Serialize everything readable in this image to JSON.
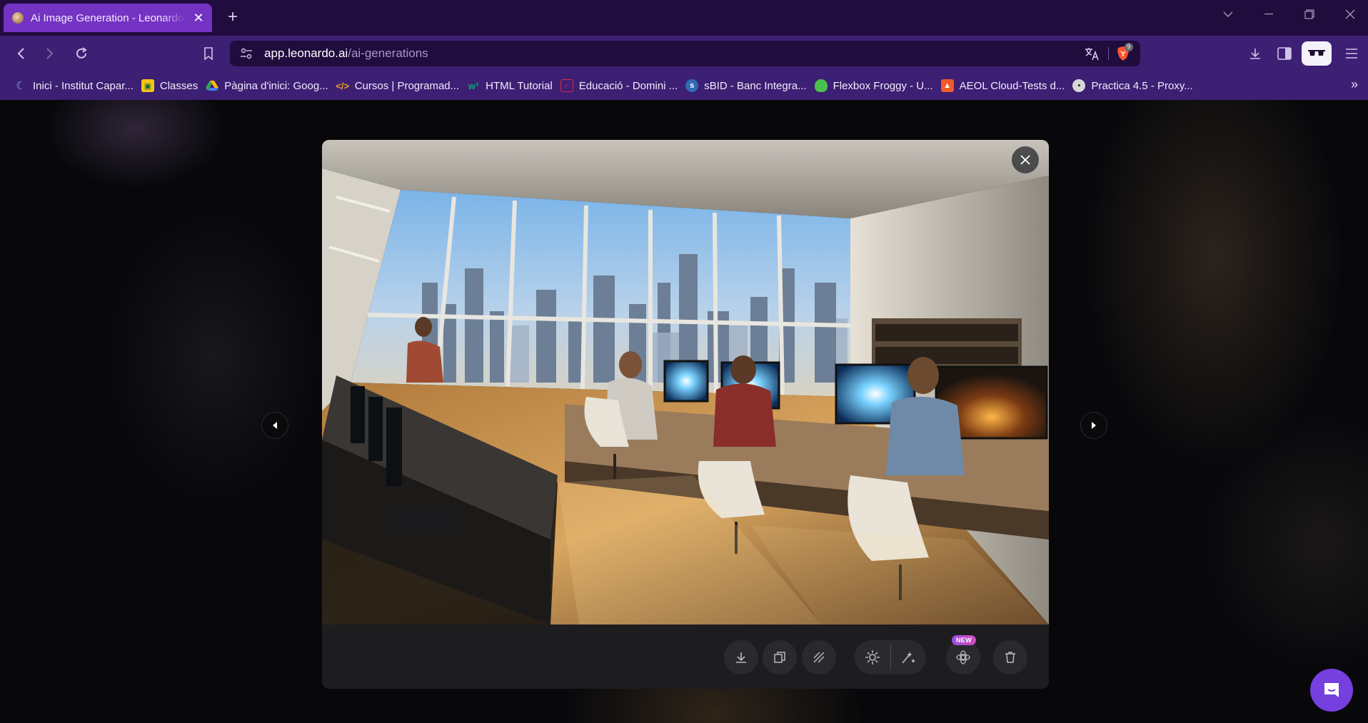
{
  "browser": {
    "tab": {
      "title": "Ai Image Generation - Leonardo.Ai",
      "close_glyph": "✕"
    },
    "new_tab_glyph": "+",
    "address": {
      "host": "app.leonardo.ai",
      "path": "/ai-generations"
    },
    "shield_count": "9",
    "bookmarks": [
      {
        "label": "Inici - Institut Capar...",
        "icon": "moon-icon",
        "color": "#8fa4ff"
      },
      {
        "label": "Classes",
        "icon": "classroom-icon",
        "color": "#f5c518"
      },
      {
        "label": "Pàgina d'inici: Goog...",
        "icon": "drive-icon",
        "color": "#34a853"
      },
      {
        "label": "Cursos | Programad...",
        "icon": "code-icon",
        "color": "#f0a030"
      },
      {
        "label": "HTML Tutorial",
        "icon": "w3-icon",
        "color": "#04aa6d"
      },
      {
        "label": "Educació - Domini ...",
        "icon": "edu-icon",
        "color": "#e0243c"
      },
      {
        "label": "sBID - Banc Integra...",
        "icon": "sbid-icon",
        "color": "#5aa0e6"
      },
      {
        "label": "Flexbox Froggy - U...",
        "icon": "frog-icon",
        "color": "#4cc04c"
      },
      {
        "label": "AEOL Cloud-Tests d...",
        "icon": "aeol-icon",
        "color": "#f05a28"
      },
      {
        "label": "Practica 4.5 - Proxy...",
        "icon": "book-icon",
        "color": "#d8d8d8"
      }
    ],
    "bookmarks_more_glyph": "»"
  },
  "viewer": {
    "actions": [
      {
        "name": "download-button",
        "icon": "download-icon"
      },
      {
        "name": "copy-button",
        "icon": "copy-icon"
      },
      {
        "name": "remove-background-button",
        "icon": "remove-background-icon"
      },
      {
        "name": "upscale-button",
        "icon": "upscale-icon"
      },
      {
        "name": "alchemy-upscale-button",
        "icon": "wand-icon"
      },
      {
        "name": "motion-button",
        "icon": "motion-icon"
      },
      {
        "name": "delete-button",
        "icon": "trash-icon"
      }
    ],
    "new_badge": "NEW"
  },
  "colors": {
    "tab_active": "#7433c2",
    "toolbar": "#3d1f74",
    "titlebar": "#200c3d",
    "chat_fab": "#7540de"
  }
}
